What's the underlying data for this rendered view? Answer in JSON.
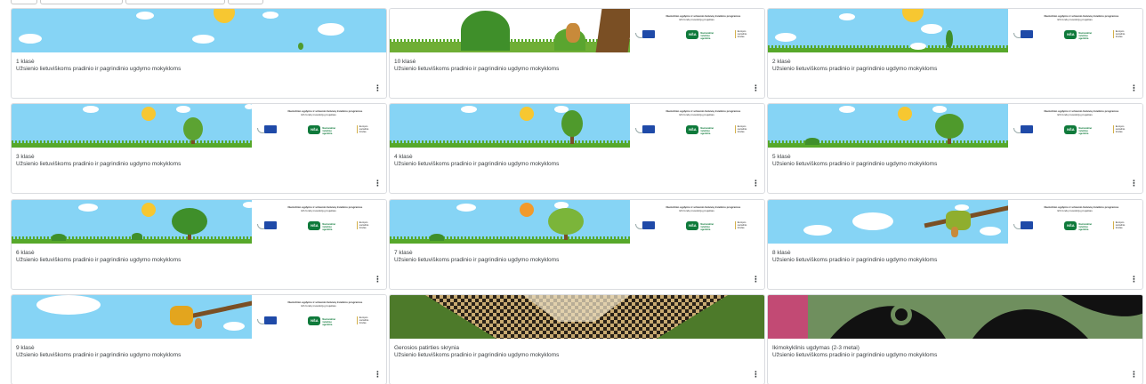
{
  "topbar": {
    "buttons": [
      "",
      "",
      "",
      ""
    ]
  },
  "logo_banner": {
    "line1": "Nuotolinio ugdymo ir užsienio lietuvių švietimo programos",
    "line2": "ES fondų investicijų projektas",
    "nsa_label": "NŠA",
    "nsa_text": "Nacionalinė švietimo agentūra",
    "fund_text": "Europos socialinis fondas"
  },
  "cards": [
    {
      "title": "1 klasė",
      "subtitle": "Užsienio lietuviškoms pradinio ir pagrindinio ugdymo mokykloms",
      "banner": "sky-plain"
    },
    {
      "title": "10 klasė",
      "subtitle": "Užsienio lietuviškoms pradinio ir pagrindinio ugdymo mokykloms",
      "banner": "acorn-forest"
    },
    {
      "title": "2 klasė",
      "subtitle": "Užsienio lietuviškoms pradinio ir pagrindinio ugdymo mokykloms",
      "banner": "sprout"
    },
    {
      "title": "3 klasė",
      "subtitle": "Užsienio lietuviškoms pradinio ir pagrindinio ugdymo mokykloms",
      "banner": "small-tree"
    },
    {
      "title": "4 klasė",
      "subtitle": "Užsienio lietuviškoms pradinio ir pagrindinio ugdymo mokykloms",
      "banner": "medium-tree"
    },
    {
      "title": "5 klasė",
      "subtitle": "Užsienio lietuviškoms pradinio ir pagrindinio ugdymo mokykloms",
      "banner": "bigger-tree"
    },
    {
      "title": "6 klasė",
      "subtitle": "Užsienio lietuviškoms pradinio ir pagrindinio ugdymo mokykloms",
      "banner": "big-tree"
    },
    {
      "title": "7 klasė",
      "subtitle": "Užsienio lietuviškoms pradinio ir pagrindinio ugdymo mokykloms",
      "banner": "apple-tree"
    },
    {
      "title": "8 klasė",
      "subtitle": "Užsienio lietuviškoms pradinio ir pagrindinio ugdymo mokykloms",
      "banner": "oak-branch"
    },
    {
      "title": "9 klasė",
      "subtitle": "Užsienio lietuviškoms pradinio ir pagrindinio ugdymo mokykloms",
      "banner": "oak-branch-2"
    },
    {
      "title": "Gerosios patirties skrynia",
      "subtitle": "Užsienio lietuviškoms pradinio ir pagrindinio ugdymo mokykloms",
      "banner": "woven-pattern"
    },
    {
      "title": "Ikimokyklinis ugdymas (2-3 metai)",
      "subtitle": "Užsienio lietuviškoms pradinio ir pagrindinio ugdymo mokykloms",
      "banner": "folk-cutout"
    }
  ],
  "more_icon": "⋮",
  "colors": {
    "sky": "#86d4f5",
    "grass": "#57a82a",
    "sun": "#f7c731",
    "text": "#3c4043"
  }
}
